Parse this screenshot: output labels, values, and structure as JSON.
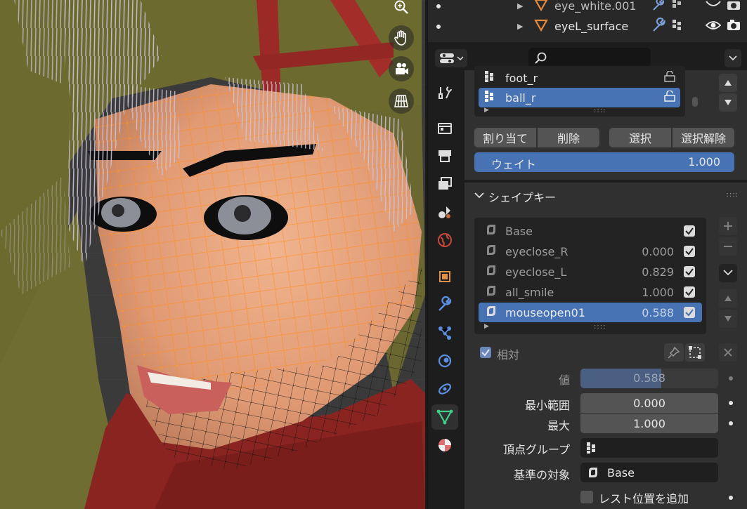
{
  "outliner": {
    "rows": [
      {
        "name": "eye_white.001"
      },
      {
        "name": "eyeL_surface"
      }
    ]
  },
  "vertex_groups": {
    "items": [
      {
        "name": "foot_r",
        "selected": false
      },
      {
        "name": "ball_r",
        "selected": true
      }
    ],
    "buttons": {
      "assign": "割り当て",
      "remove": "削除",
      "select": "選択",
      "deselect": "選択解除"
    },
    "weight_label": "ウェイト",
    "weight_value": "1.000"
  },
  "shape_keys": {
    "title": "シェイプキー",
    "items": [
      {
        "name": "Base",
        "value": "",
        "selected": false
      },
      {
        "name": "eyeclose_R",
        "value": "0.000",
        "selected": false
      },
      {
        "name": "eyeclose_L",
        "value": "0.829",
        "selected": false
      },
      {
        "name": "all_smile",
        "value": "1.000",
        "selected": false
      },
      {
        "name": "mouseopen01",
        "value": "0.588",
        "selected": true
      }
    ],
    "relative_label": "相対",
    "value_label": "値",
    "value": "0.588",
    "value_fraction": 0.588,
    "range_min_label": "最小範囲",
    "range_min": "0.000",
    "range_max_label": "最大",
    "range_max": "1.000",
    "vertex_group_label": "頂点グループ",
    "relative_to_label": "基準の対象",
    "relative_to_value": "Base",
    "add_rest_label": "レスト位置を追加"
  },
  "colors": {
    "accent": "#4772b3",
    "selection_orange": "#ff8a1c",
    "panel": "#303030"
  }
}
